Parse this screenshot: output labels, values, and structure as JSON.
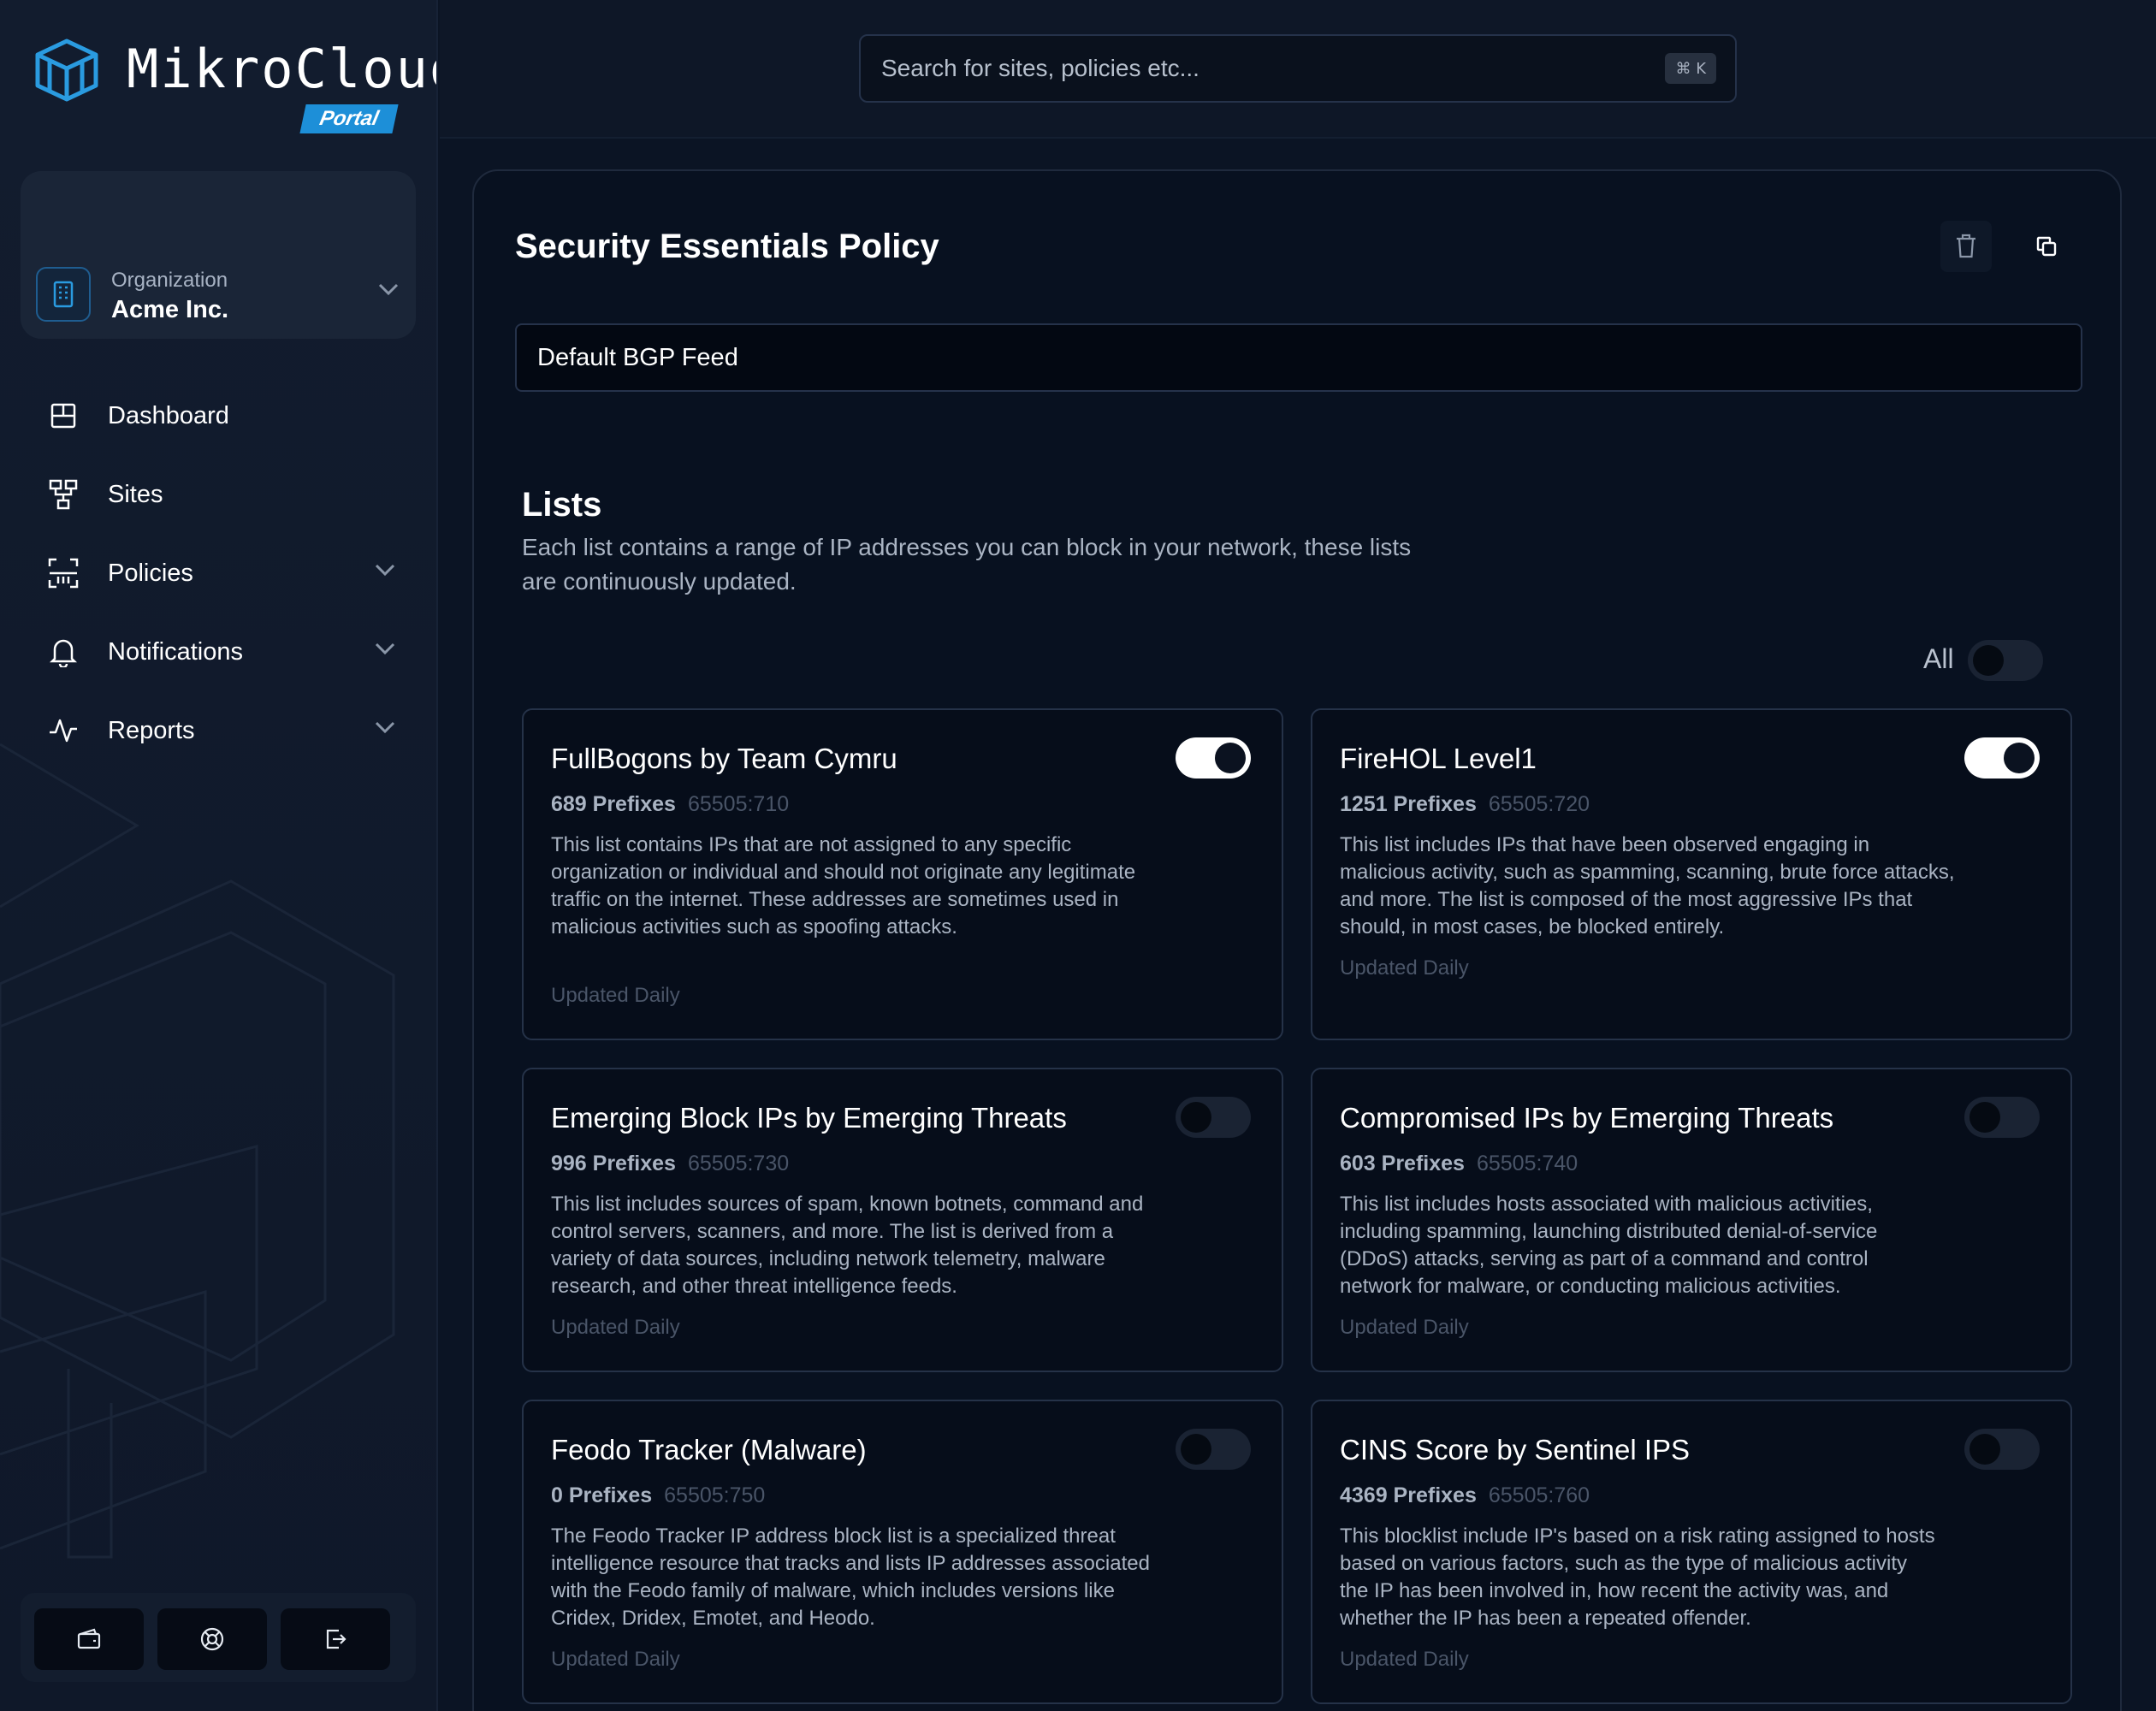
{
  "app": {
    "name": "MikroCloud",
    "badge": "Portal"
  },
  "org": {
    "label": "Organization",
    "name": "Acme Inc."
  },
  "nav": [
    {
      "label": "Dashboard",
      "icon": "dashboard-icon",
      "expandable": false
    },
    {
      "label": "Sites",
      "icon": "sites-icon",
      "expandable": false
    },
    {
      "label": "Policies",
      "icon": "policies-icon",
      "expandable": true
    },
    {
      "label": "Notifications",
      "icon": "bell-icon",
      "expandable": true
    },
    {
      "label": "Reports",
      "icon": "activity-icon",
      "expandable": true
    }
  ],
  "bottom_actions": [
    "wallet-icon",
    "lifebuoy-icon",
    "logout-icon"
  ],
  "search": {
    "placeholder": "Search for sites, policies etc...",
    "shortcut": "⌘ K"
  },
  "policy": {
    "title": "Security Essentials Policy",
    "feed": "Default BGP Feed"
  },
  "lists": {
    "title": "Lists",
    "description": "Each list contains a range of IP addresses you can block in your network, these lists are continuously updated.",
    "all_label": "All",
    "all_enabled": false,
    "items": [
      {
        "title": "FullBogons by Team Cymru",
        "prefixes": "689 Prefixes",
        "asn": "65505:710",
        "description": "This list contains IPs that are not assigned to any specific organization or individual and should not originate any legitimate traffic on the internet. These addresses are sometimes used in malicious activities such as spoofing attacks.",
        "updated": "Updated Daily",
        "enabled": true
      },
      {
        "title": "FireHOL Level1",
        "prefixes": "1251 Prefixes",
        "asn": "65505:720",
        "description": "This list includes IPs that have been observed engaging in malicious activity, such as spamming, scanning, brute force attacks, and more. The list is composed of the most aggressive IPs that should, in most cases, be blocked entirely.",
        "updated": "Updated Daily",
        "enabled": true
      },
      {
        "title": "Emerging Block IPs by Emerging Threats",
        "prefixes": "996 Prefixes",
        "asn": "65505:730",
        "description": "This list includes sources of spam, known botnets, command and control servers, scanners, and more. The list is derived from a variety of data sources, including network telemetry, malware research, and other threat intelligence feeds.",
        "updated": "Updated Daily",
        "enabled": false
      },
      {
        "title": "Compromised IPs by Emerging Threats",
        "prefixes": "603 Prefixes",
        "asn": "65505:740",
        "description": "This list includes hosts associated with malicious activities, including spamming, launching distributed denial-of-service (DDoS) attacks, serving as part of a command and control network for malware, or conducting malicious activities.",
        "updated": "Updated Daily",
        "enabled": false
      },
      {
        "title": "Feodo Tracker (Malware)",
        "prefixes": "0 Prefixes",
        "asn": "65505:750",
        "description": "The Feodo Tracker IP address block list is a specialized threat intelligence resource that tracks and lists IP addresses associated with the Feodo family of malware, which includes versions like Cridex, Dridex, Emotet, and Heodo.",
        "updated": "Updated Daily",
        "enabled": false
      },
      {
        "title": "CINS Score by Sentinel IPS",
        "prefixes": "4369 Prefixes",
        "asn": "65505:760",
        "description": "This blocklist include IP's based on a risk rating assigned to hosts based on various factors, such as the type of malicious activity the IP has been involved in, how recent the activity was, and whether the IP has been a repeated offender.",
        "updated": "Updated Daily",
        "enabled": false
      }
    ]
  },
  "colors": {
    "background": "#0b1424",
    "sidebar": "#121c2e",
    "panel": "#081120",
    "accent": "#1d8fd8",
    "card_border": "#253248",
    "muted_text": "#aab4c3",
    "faint_text": "#4a5568"
  }
}
